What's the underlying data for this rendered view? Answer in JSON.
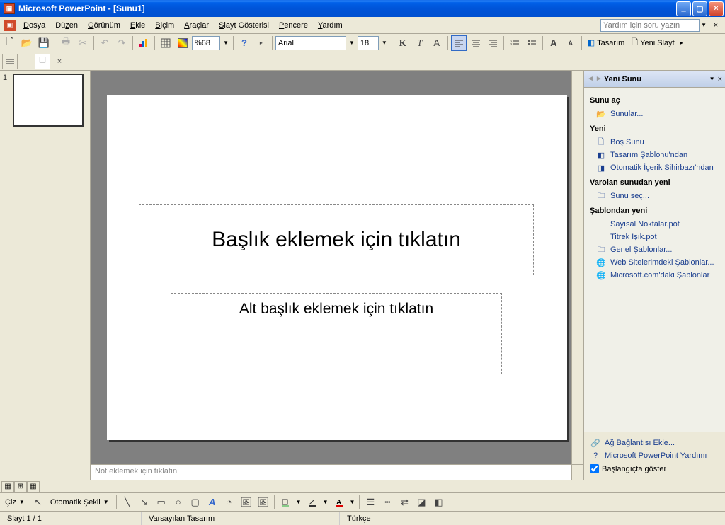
{
  "titlebar": {
    "text": "Microsoft PowerPoint - [Sunu1]"
  },
  "menus": {
    "file": "Dosya",
    "edit": "Düzen",
    "view": "Görünüm",
    "insert": "Ekle",
    "format": "Biçim",
    "tools": "Araçlar",
    "slideshow": "Slayt Gösterisi",
    "window": "Pencere",
    "help": "Yardım"
  },
  "help_placeholder": "Yardım için soru yazın",
  "toolbar": {
    "zoom": "%68",
    "font": "Arial",
    "size": "18",
    "design": "Tasarım",
    "newslide": "Yeni Slayt"
  },
  "slide": {
    "number": "1",
    "title_placeholder": "Başlık eklemek için tıklatın",
    "subtitle_placeholder": "Alt başlık eklemek için tıklatın"
  },
  "notes_placeholder": "Not eklemek için tıklatın",
  "taskpane": {
    "title": "Yeni Sunu",
    "sec_open": "Sunu aç",
    "open_presentations": "Sunular...",
    "sec_new": "Yeni",
    "blank": "Boş Sunu",
    "from_template": "Tasarım Şablonu'ndan",
    "from_wizard": "Otomatik İçerik Sihirbazı'ndan",
    "sec_existing": "Varolan sunudan yeni",
    "choose": "Sunu seç...",
    "sec_template": "Şablondan yeni",
    "tpl1": "Sayısal Noktalar.pot",
    "tpl2": "Titrek Işık.pot",
    "general_tpl": "Genel Şablonlar...",
    "web_tpl": "Web Sitelerimdeki Şablonlar...",
    "ms_tpl": "Microsoft.com'daki Şablonlar",
    "add_network": "Ağ Bağlantısı Ekle...",
    "pp_help": "Microsoft PowerPoint Yardımı",
    "show_startup": "Başlangıçta göster"
  },
  "draw": {
    "menu": "Çiz",
    "autoshape": "Otomatik Şekil"
  },
  "status": {
    "slide": "Slayt 1 / 1",
    "design": "Varsayılan Tasarım",
    "lang": "Türkçe"
  }
}
